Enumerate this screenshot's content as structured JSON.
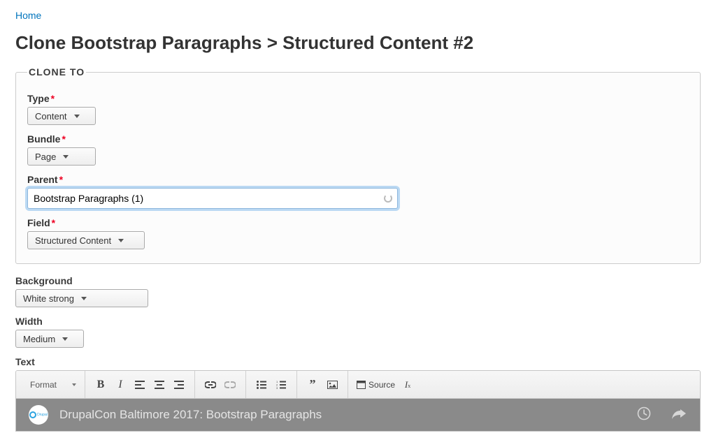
{
  "breadcrumb": {
    "home": "Home"
  },
  "page_title": "Clone Bootstrap Paragraphs > Structured Content #2",
  "fieldset_legend": "CLONE TO",
  "form": {
    "type": {
      "label": "Type",
      "value": "Content"
    },
    "bundle": {
      "label": "Bundle",
      "value": "Page"
    },
    "parent": {
      "label": "Parent",
      "value": "Bootstrap Paragraphs (1)"
    },
    "field": {
      "label": "Field",
      "value": "Structured Content"
    }
  },
  "background": {
    "label": "Background",
    "value": "White strong"
  },
  "width": {
    "label": "Width",
    "value": "Medium"
  },
  "text_label": "Text",
  "toolbar": {
    "format_label": "Format",
    "source_label": "Source"
  },
  "video": {
    "title": "DrupalCon Baltimore 2017: Bootstrap Paragraphs",
    "logo_text": "Drupal"
  }
}
